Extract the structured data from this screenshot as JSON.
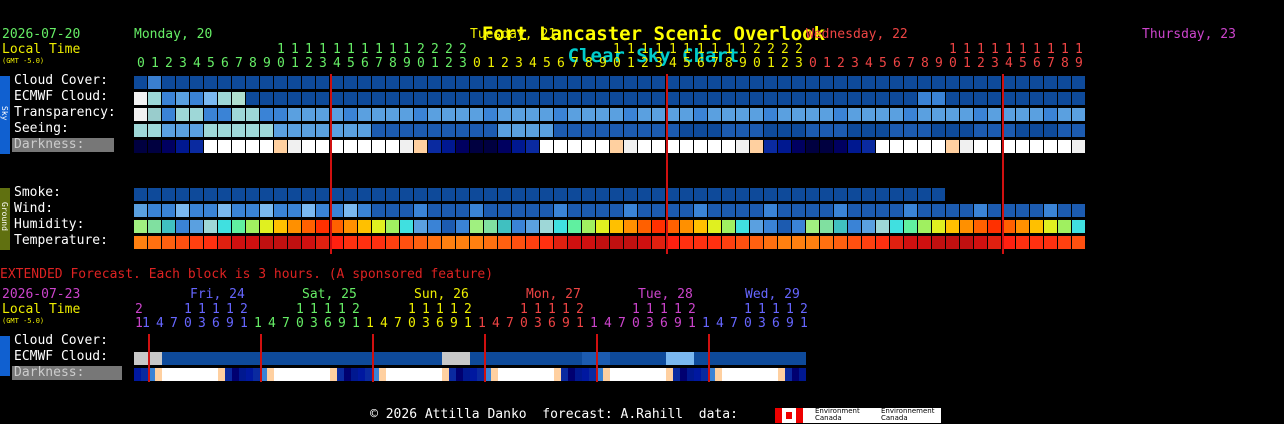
{
  "page": {
    "title_a": "Fort Lancaster Scenic Overlook",
    "title_b": "Clear Sky Chart",
    "colors": {
      "title_a": "#ffff00",
      "title_b": "#00cccc"
    }
  },
  "main": {
    "date": "2026-07-20",
    "local_time": "Local Time",
    "gmt": "(GMT -5.0)",
    "days": [
      {
        "label": "Monday, 20",
        "color": "#66ee66"
      },
      {
        "label": "Tuesday, 21",
        "color": "#eeee00"
      },
      {
        "label": "Wednesday, 22",
        "color": "#ee4444"
      },
      {
        "label": "Thursday, 23",
        "color": "#cc44cc"
      }
    ],
    "hours_start": 0,
    "hours_count": 68,
    "labels": {
      "cloud": "Cloud Cover:",
      "ecmwf": "ECMWF Cloud:",
      "transp": "Transparency:",
      "seeing": "Seeing:",
      "dark": "Darkness:",
      "smoke": "Smoke:",
      "wind": "Wind:",
      "humid": "Humidity:",
      "temp": "Temperature:"
    },
    "side_tabs": {
      "sky": "Sky",
      "ground": "Ground"
    }
  },
  "extended": {
    "note": "EXTENDED Forecast. Each block is 3 hours. (A sponsored feature)",
    "date": "2026-07-23",
    "local_time": "Local Time",
    "gmt": "(GMT -5.0)",
    "days": [
      {
        "label": "Fri, 24",
        "color": "#6666ff"
      },
      {
        "label": "Sat, 25",
        "color": "#66ee66"
      },
      {
        "label": "Sun, 26",
        "color": "#eeee00"
      },
      {
        "label": "Mon, 27",
        "color": "#ee4444"
      },
      {
        "label": "Tue, 28",
        "color": "#cc44cc"
      },
      {
        "label": "Wed, 29",
        "color": "#6666ff"
      }
    ],
    "labels": {
      "cloud": "Cloud Cover:",
      "ecmwf": "ECMWF Cloud:",
      "dark": "Darkness:"
    }
  },
  "footer": {
    "text": "© 2026 Attilla Danko  forecast: A.Rahill  data:",
    "agency1": "Environment Canada",
    "agency2": "Environnement Canada"
  }
}
